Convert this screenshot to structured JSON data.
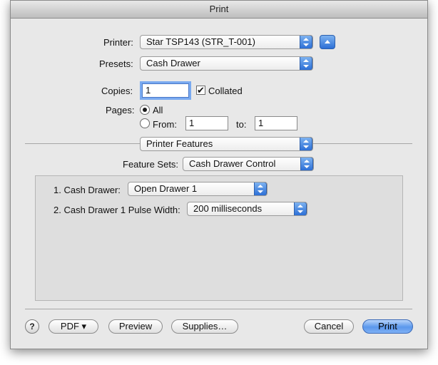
{
  "window": {
    "title": "Print"
  },
  "printer": {
    "label": "Printer:",
    "value": "Star TSP143 (STR_T-001)"
  },
  "presets": {
    "label": "Presets:",
    "value": "Cash Drawer"
  },
  "copies": {
    "label": "Copies:",
    "value": "1",
    "collated_label": "Collated",
    "collated_checked": true
  },
  "pages": {
    "label": "Pages:",
    "all_label": "All",
    "from_label": "From:",
    "from_value": "1",
    "to_label": "to:",
    "to_value": "1"
  },
  "section_popup": {
    "value": "Printer Features"
  },
  "feature_sets": {
    "label": "Feature Sets:",
    "value": "Cash Drawer Control"
  },
  "panel": {
    "cash_drawer": {
      "label": "1. Cash Drawer:",
      "value": "Open Drawer 1"
    },
    "pulse_width": {
      "label": "2. Cash Drawer 1 Pulse Width:",
      "value": "200 milliseconds"
    }
  },
  "footer": {
    "help_label": "?",
    "pdf_label": "PDF ▾",
    "preview_label": "Preview",
    "supplies_label": "Supplies…",
    "cancel_label": "Cancel",
    "print_label": "Print"
  }
}
